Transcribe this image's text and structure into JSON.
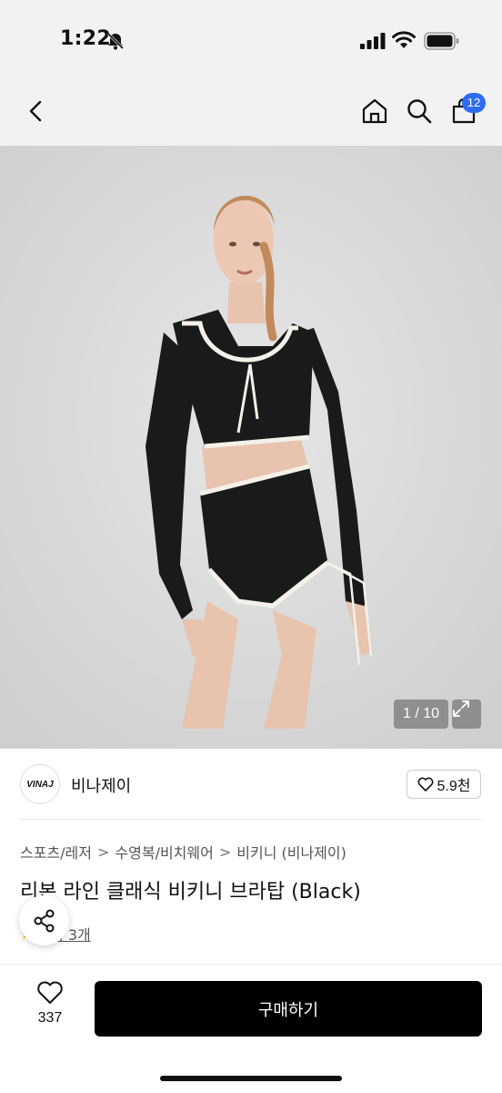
{
  "status_bar": {
    "time": "1:22",
    "icons": [
      "bell-muted-icon",
      "signal-icon",
      "wifi-icon",
      "battery-icon"
    ]
  },
  "nav": {
    "back_icon": "chevron-left-icon",
    "home_icon": "home-icon",
    "search_icon": "search-icon",
    "cart_icon": "shopping-bag-icon",
    "cart_badge": "12"
  },
  "gallery": {
    "counter": "1 / 10",
    "expand_icon": "expand-icon"
  },
  "seller": {
    "logo_text": "VINAJ",
    "name": "비나제이",
    "like_count": "5.9천"
  },
  "product": {
    "breadcrumb": [
      "스포츠/레저",
      "수영복/비치웨어",
      "비키니 (비나제이)"
    ],
    "title": "리본 라인 클래식 비키니 브라탑 (Black)",
    "review_text": "후기 3개"
  },
  "bottom_bar": {
    "wish_count": "337",
    "buy_label": "구매하기"
  },
  "colors": {
    "accent_badge": "#2e6cf6",
    "buy_button": "#000000",
    "header_bg": "#f2f2f2"
  }
}
